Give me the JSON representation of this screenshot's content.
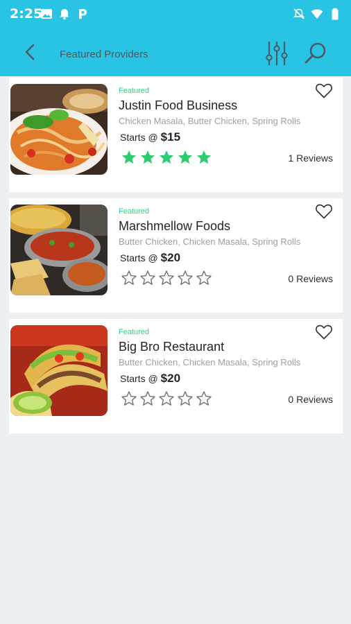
{
  "status_bar": {
    "time": "2:25",
    "left_icons": [
      "image-icon",
      "notification-bell-icon",
      "parking-p-icon"
    ],
    "right_icons": [
      "mute-icon",
      "wifi-icon",
      "battery-icon"
    ]
  },
  "app_bar": {
    "title": "Featured Providers",
    "icons": {
      "back": "chevron-left-icon",
      "filter": "sliders-icon",
      "search": "search-icon"
    }
  },
  "colors": {
    "accent": "#29c3e3",
    "featured": "#3bcb7e",
    "star_filled": "#2ecc71",
    "star_empty": "#6b7075"
  },
  "providers": [
    {
      "featured_label": "Featured",
      "name": "Justin Food Business",
      "categories": "Chicken Masala, Butter Chicken, Spring Rolls",
      "starts_label": "Starts @",
      "price": "$15",
      "rating": 5,
      "reviews": "1 Reviews",
      "image": "noodle-dish-photo"
    },
    {
      "featured_label": "Featured",
      "name": "Marshmellow Foods",
      "categories": "Butter Chicken, Chicken Masala, Spring Rolls",
      "starts_label": "Starts @",
      "price": "$20",
      "rating": 0,
      "reviews": "0 Reviews",
      "image": "indian-curry-photo"
    },
    {
      "featured_label": "Featured",
      "name": "Big Bro Restaurant",
      "categories": "Butter Chicken, Chicken Masala, Spring Rolls",
      "starts_label": "Starts @",
      "price": "$20",
      "rating": 0,
      "reviews": "0 Reviews",
      "image": "tacos-photo"
    }
  ]
}
